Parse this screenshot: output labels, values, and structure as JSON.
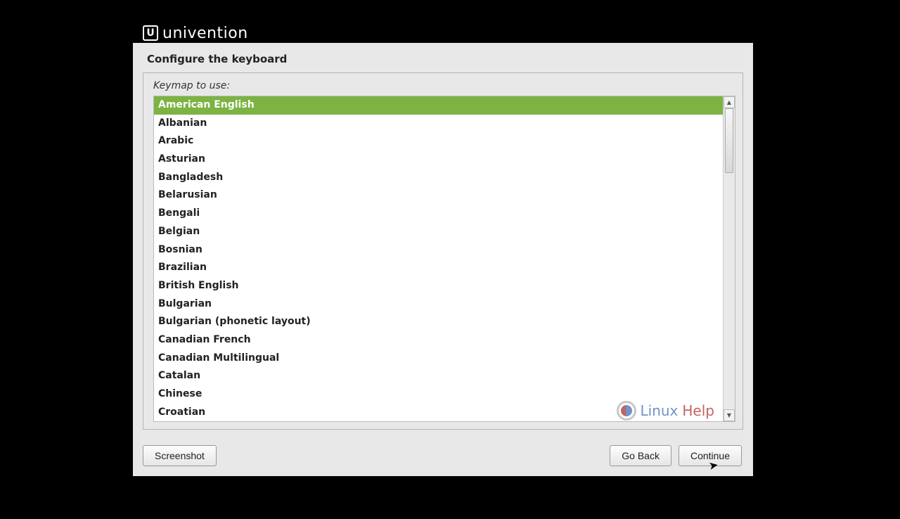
{
  "brand": {
    "icon_letter": "U",
    "name": "univention"
  },
  "title": "Configure the keyboard",
  "prompt": "Keymap to use:",
  "selected_index": 0,
  "keymaps": [
    "American English",
    "Albanian",
    "Arabic",
    "Asturian",
    "Bangladesh",
    "Belarusian",
    "Bengali",
    "Belgian",
    "Bosnian",
    "Brazilian",
    "British English",
    "Bulgarian",
    "Bulgarian (phonetic layout)",
    "Canadian French",
    "Canadian Multilingual",
    "Catalan",
    "Chinese",
    "Croatian"
  ],
  "buttons": {
    "screenshot": "Screenshot",
    "go_back": "Go Back",
    "continue": "Continue"
  },
  "watermark": {
    "part1": "Linux",
    "part2": "Help"
  }
}
